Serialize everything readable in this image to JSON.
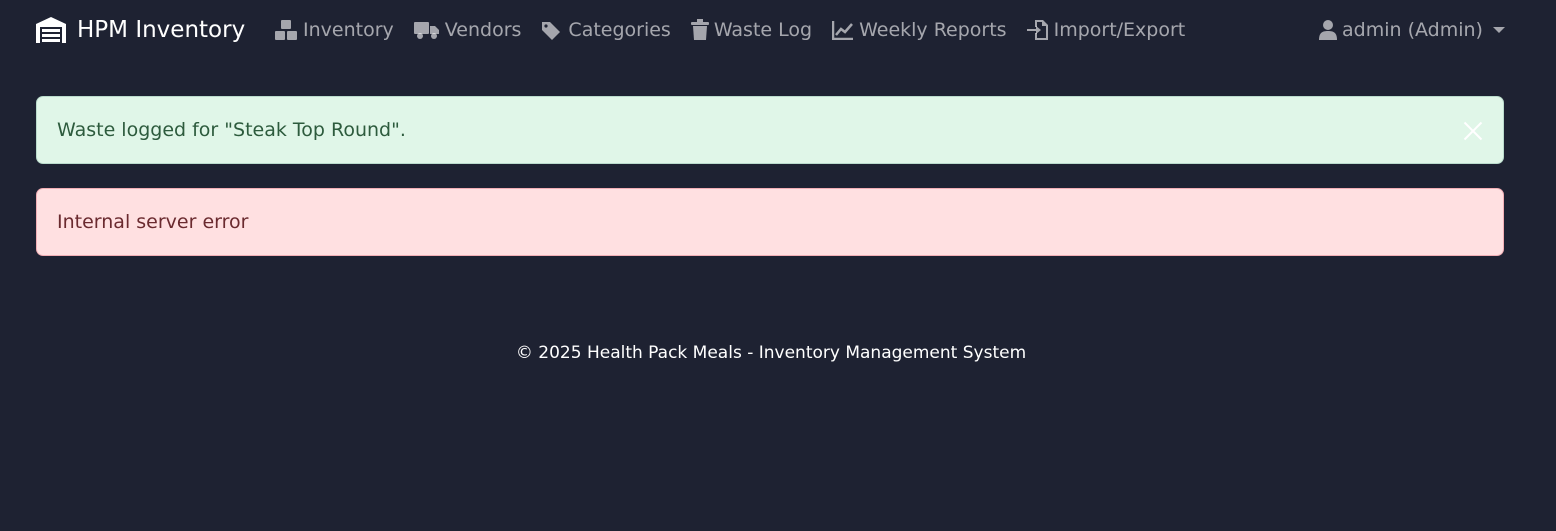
{
  "navbar": {
    "brand": "HPM Inventory",
    "links": [
      {
        "label": "Inventory",
        "icon": "boxes-icon"
      },
      {
        "label": "Vendors",
        "icon": "truck-icon"
      },
      {
        "label": "Categories",
        "icon": "tags-icon"
      },
      {
        "label": "Waste Log",
        "icon": "trash-icon"
      },
      {
        "label": "Weekly Reports",
        "icon": "chart-line-icon"
      },
      {
        "label": "Import/Export",
        "icon": "import-icon"
      }
    ],
    "user": "admin (Admin)"
  },
  "alerts": {
    "success": "Waste logged for \"Steak Top Round\".",
    "error": "Internal server error"
  },
  "footer": {
    "text": "© 2025 Health Pack Meals - Inventory Management System"
  },
  "colors": {
    "background": "#1e2232",
    "success_bg": "#e0f6e8",
    "danger_bg": "#ffe0e1"
  }
}
